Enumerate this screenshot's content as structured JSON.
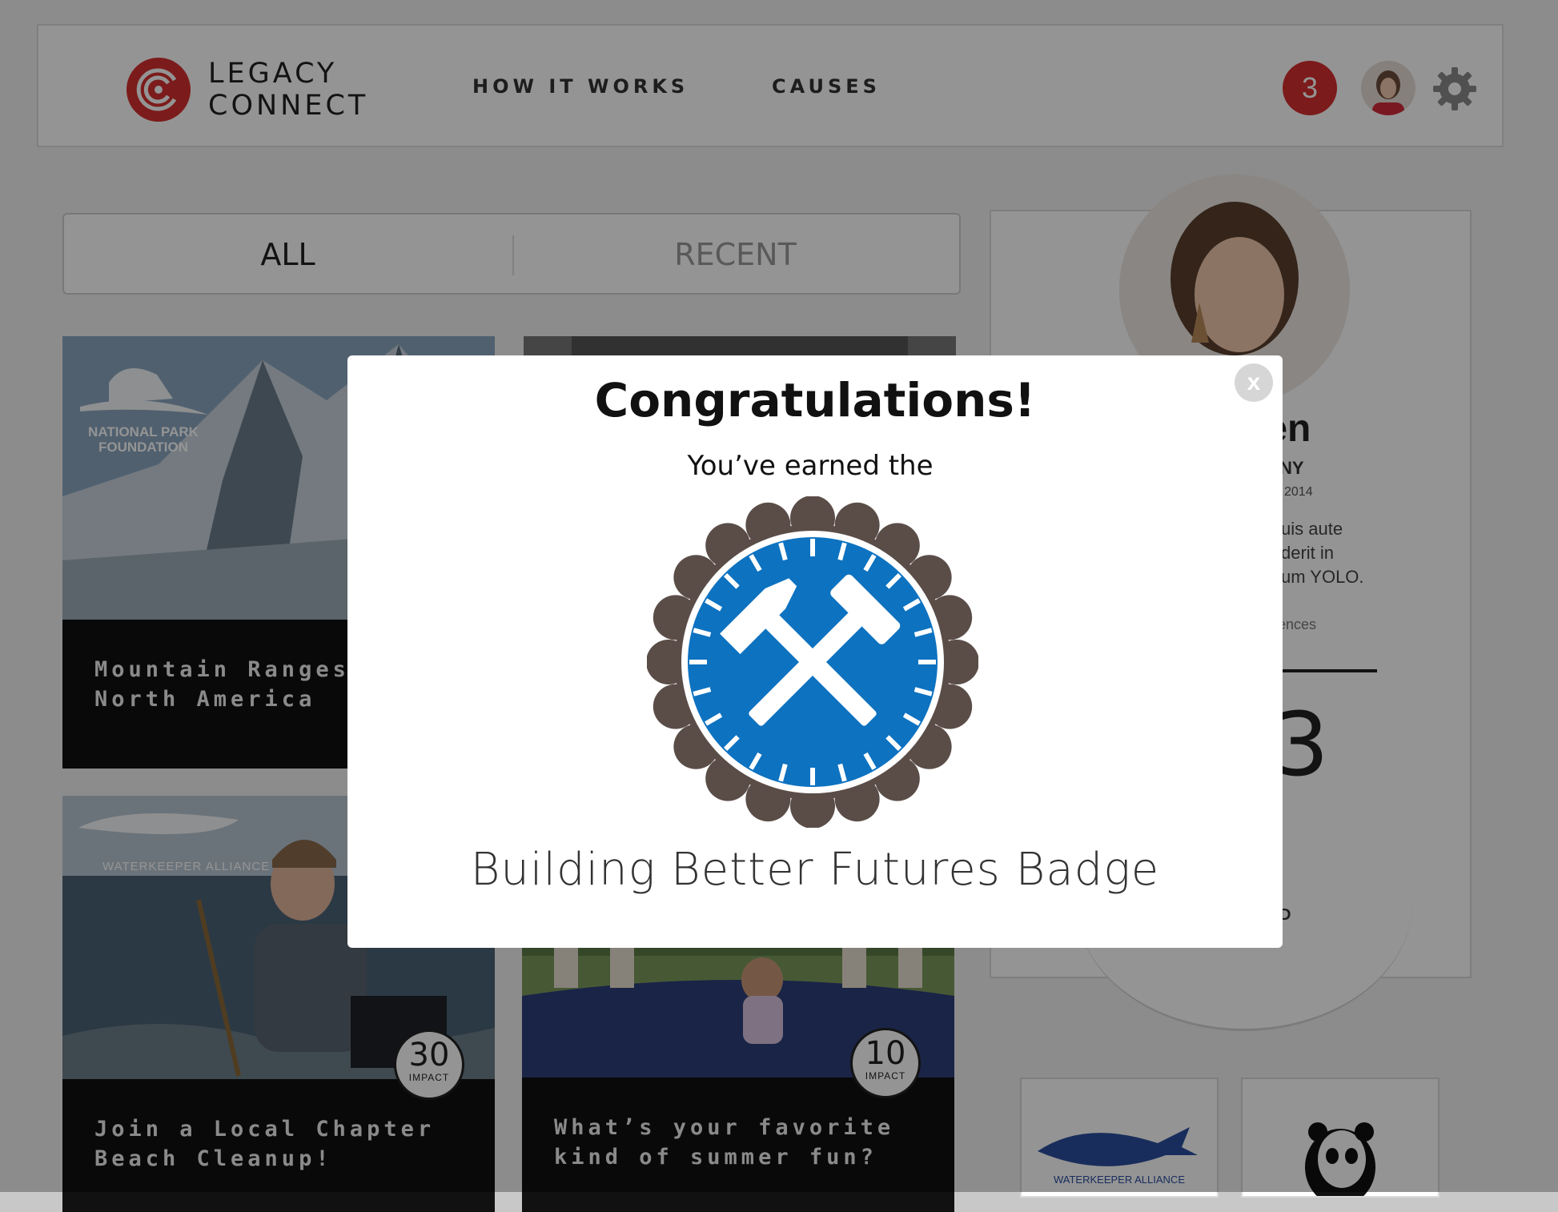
{
  "header": {
    "logo_line1": "LEGACY",
    "logo_line2": "CONNECT",
    "nav": [
      "HOW IT WORKS",
      "CAUSES"
    ],
    "notification_count": "3",
    "brand_color": "#d62f2f"
  },
  "tabs": {
    "all": "ALL",
    "recent": "RECENT"
  },
  "cards": [
    {
      "org": "NATIONAL PARK FOUNDATION",
      "title": "Mountain Ranges\nNorth America"
    },
    {
      "org": "WATERKEEPER ALLIANCE",
      "title": "Join a Local Chapter\nBeach Cleanup!",
      "impact": "30",
      "impact_label": "IMPACT"
    },
    {
      "title": "What’s your favorite\nkind of summer fun?",
      "impact": "10",
      "impact_label": "IMPACT"
    }
  ],
  "profile": {
    "name_fragment": "den",
    "location_fragment": "NY",
    "date_fragment": "2014",
    "bio_fragment": "uis aute\nderit in\num YOLO.",
    "influences_fragment": "ences",
    "number_fragment": "3",
    "label_fragment": "D"
  },
  "orgs": [
    {
      "name": "WATERKEEPER ALLIANCE",
      "icon": "shark-logo-icon"
    },
    {
      "icon": "panda-logo-icon"
    }
  ],
  "modal": {
    "title": "Congratulations!",
    "subtitle": "You’ve earned the",
    "badge_name": "Building Better Futures Badge",
    "badge_icon": "crossed-hammers-icon",
    "close_label": "x",
    "badge_colors": {
      "ring": "#5a4d48",
      "inner": "#0d72c0"
    }
  }
}
